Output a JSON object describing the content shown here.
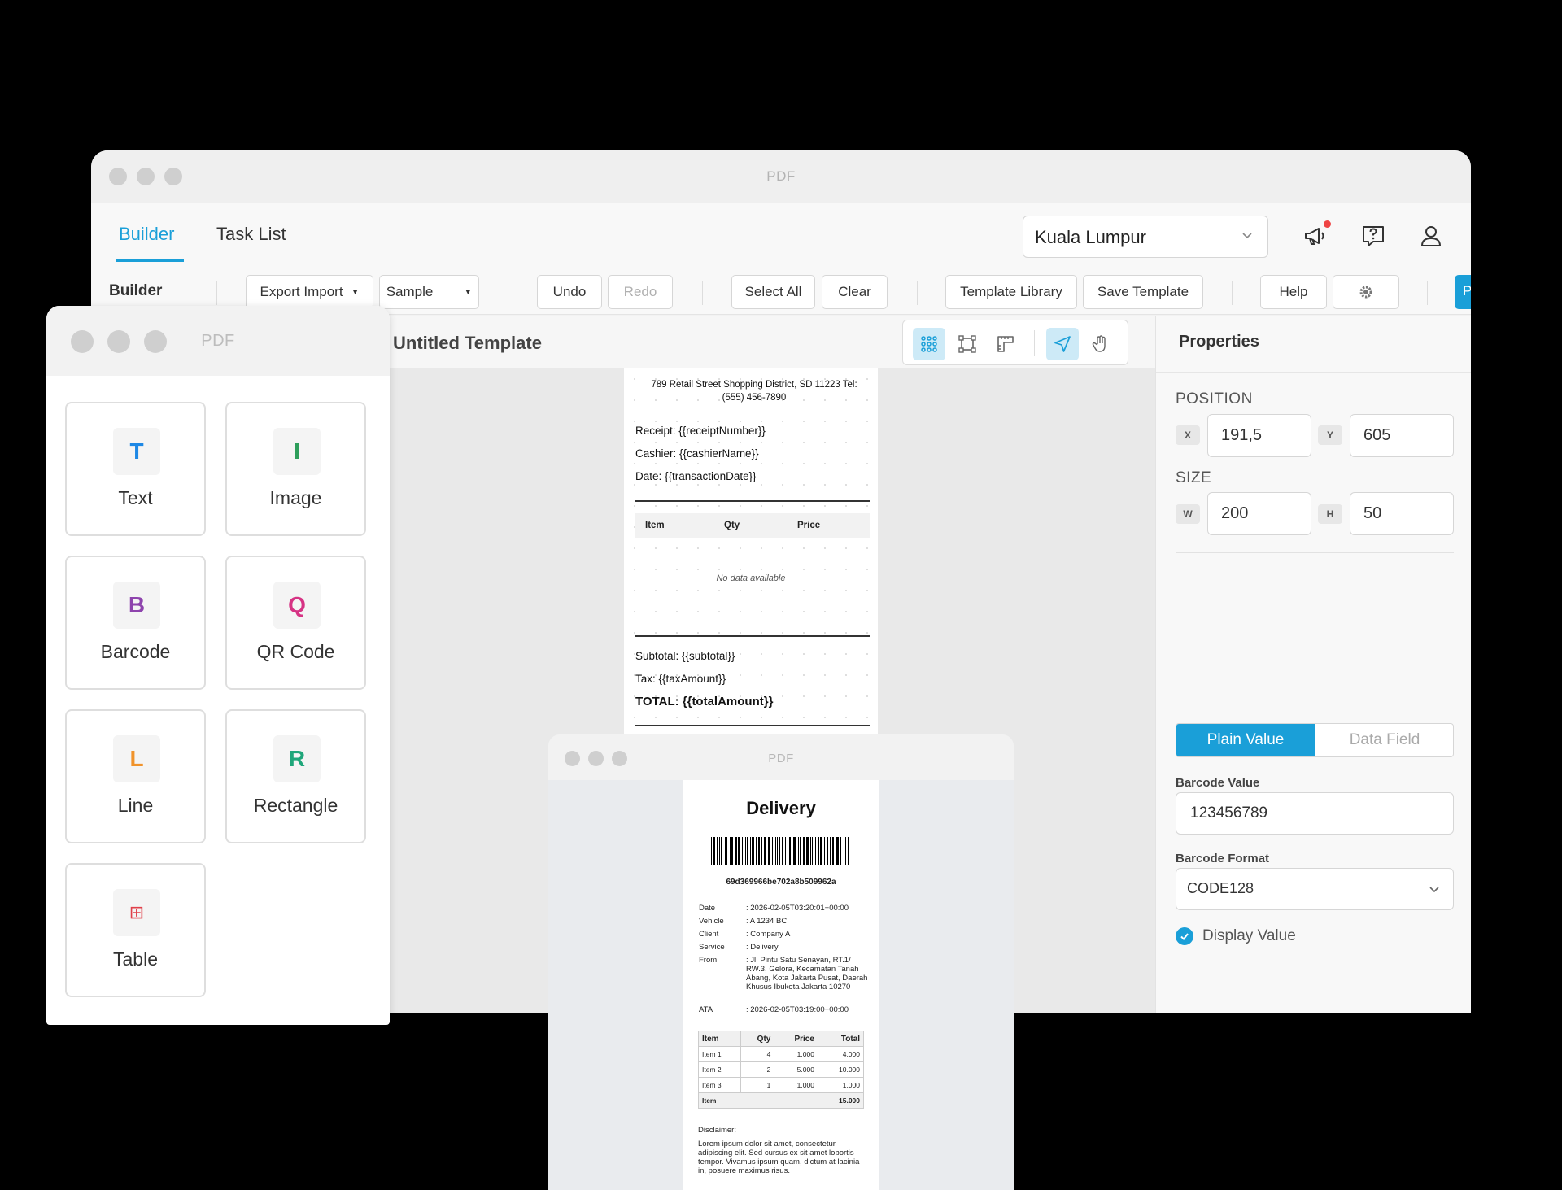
{
  "main_window": {
    "title": "PDF",
    "tabs": [
      {
        "label": "Builder"
      },
      {
        "label": "Task List"
      }
    ],
    "location": "Kuala Lumpur",
    "toolbar": {
      "section_label": "Builder",
      "export_import": "Export Import",
      "sample": "Sample",
      "undo": "Undo",
      "redo": "Redo",
      "select_all": "Select All",
      "clear": "Clear",
      "template_library": "Template Library",
      "save_template": "Save Template",
      "help": "Help",
      "cut_off_button": "P"
    },
    "canvas": {
      "template_name": "Untitled Template",
      "address": "789 Retail Street Shopping District, SD 11223 Tel: (555) 456-7890",
      "receipt": "Receipt: {{receiptNumber}}",
      "cashier": "Cashier: {{cashierName}}",
      "date": "Date: {{transactionDate}}",
      "table_headers": [
        "Item",
        "Qty",
        "Price"
      ],
      "empty_text": "No data available",
      "subtotal": "Subtotal: {{subtotal}}",
      "tax": "Tax: {{taxAmount}}",
      "total": "TOTAL: {{totalAmount}}"
    },
    "properties": {
      "title": "Properties",
      "position_label": "POSITION",
      "x_tag": "X",
      "x_value": "191,5",
      "y_tag": "Y",
      "y_value": "605",
      "size_label": "SIZE",
      "w_tag": "W",
      "w_value": "200",
      "h_tag": "H",
      "h_value": "50",
      "mode_plain": "Plain Value",
      "mode_field": "Data Field",
      "barcode_value_label": "Barcode Value",
      "barcode_value": "123456789",
      "barcode_format_label": "Barcode Format",
      "barcode_format": "CODE128",
      "display_value_label": "Display Value",
      "display_value_checked": true
    }
  },
  "element_panel": {
    "title": "PDF",
    "items": [
      {
        "letter": "T",
        "label": "Text",
        "color": "#1e88e5"
      },
      {
        "letter": "I",
        "label": "Image",
        "color": "#2e9e5b"
      },
      {
        "letter": "B",
        "label": "Barcode",
        "color": "#8e44ad"
      },
      {
        "letter": "Q",
        "label": "QR Code",
        "color": "#d63384"
      },
      {
        "letter": "L",
        "label": "Line",
        "color": "#f0932b"
      },
      {
        "letter": "R",
        "label": "Rectangle",
        "color": "#1fa67a"
      },
      {
        "letter": "⊞",
        "label": "Table",
        "color": "#e0404a"
      }
    ]
  },
  "preview_window": {
    "title": "PDF",
    "doc_title": "Delivery",
    "code": "69d369966be702a8b509962a",
    "fields": [
      {
        "k": "Date",
        "v": ": 2026-02-05T03:20:01+00:00"
      },
      {
        "k": "Vehicle",
        "v": ": A 1234 BC"
      },
      {
        "k": "Client",
        "v": ": Company A"
      },
      {
        "k": "Service",
        "v": ": Delivery"
      },
      {
        "k": "From",
        "v": ": Jl. Pintu Satu Senayan, RT.1/ RW.3, Gelora, Kecamatan Tanah Abang, Kota Jakarta Pusat, Daerah Khusus Ibukota Jakarta 10270"
      },
      {
        "k": "ATA",
        "v": ": 2026-02-05T03:19:00+00:00"
      }
    ],
    "table": {
      "headers": [
        "Item",
        "Qty",
        "Price",
        "Total"
      ],
      "rows": [
        [
          "Item 1",
          "4",
          "1.000",
          "4.000"
        ],
        [
          "Item 2",
          "2",
          "5.000",
          "10.000"
        ],
        [
          "Item 3",
          "1",
          "1.000",
          "1.000"
        ]
      ],
      "footer": [
        "Item",
        "15.000"
      ]
    },
    "disclaimer_label": "Disclaimer:",
    "disclaimer": "Lorem ipsum dolor sit amet, consectetur adipiscing elit. Sed cursus ex sit amet lobortis tempor. Vivamus ipsum quam, dictum at lacinia in, posuere maximus risus."
  },
  "colors": {
    "accent": "#1a9fd8",
    "notification": "#ef4444"
  }
}
